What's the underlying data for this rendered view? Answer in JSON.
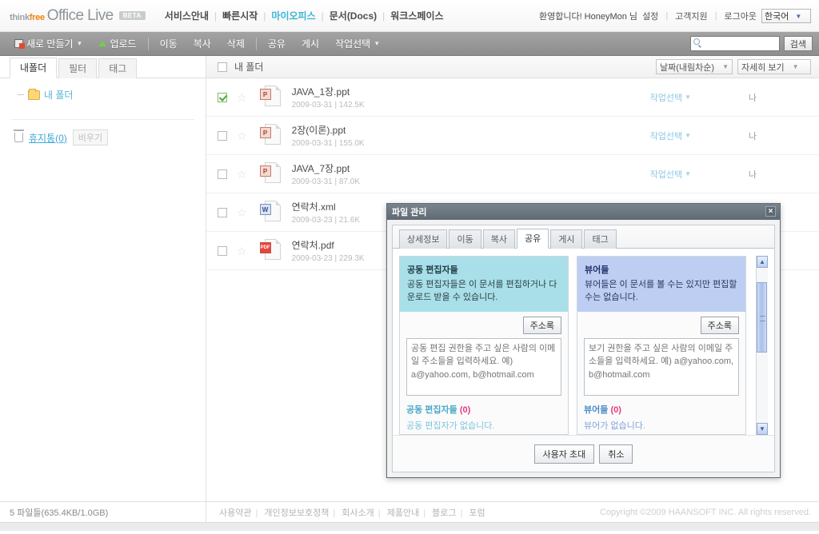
{
  "header": {
    "logo": {
      "think": "think",
      "free": "free",
      "product": "Office Live",
      "beta": "BETA"
    },
    "nav": [
      {
        "label": "서비스안내",
        "active": false
      },
      {
        "label": "빠른시작",
        "active": false
      },
      {
        "label": "마이오피스",
        "active": true
      },
      {
        "label": "문서(Docs)",
        "active": false
      },
      {
        "label": "워크스페이스",
        "active": false
      }
    ],
    "welcome": "환영합니다! HoneyMon 님",
    "links": [
      {
        "label": "설정"
      },
      {
        "label": "고객지원"
      },
      {
        "label": "로그아웃"
      }
    ],
    "language": "한국어"
  },
  "toolbar": {
    "items": [
      {
        "label": "새로 만들기",
        "icon": "new-document-icon",
        "caret": true
      },
      {
        "label": "업로드",
        "icon": "upload-icon",
        "caret": false
      },
      {
        "label": "이동",
        "icon": "",
        "caret": false
      },
      {
        "label": "복사",
        "icon": "",
        "caret": false
      },
      {
        "label": "삭제",
        "icon": "",
        "caret": false
      },
      {
        "label": "공유",
        "icon": "",
        "caret": false
      },
      {
        "label": "게시",
        "icon": "",
        "caret": false
      },
      {
        "label": "작업선택",
        "icon": "",
        "caret": true
      }
    ],
    "search": {
      "value": "",
      "placeholder": "",
      "button_label": "검색"
    }
  },
  "sidebar": {
    "tabs": [
      {
        "label": "내폴더",
        "active": true
      },
      {
        "label": "필터",
        "active": false
      },
      {
        "label": "태그",
        "active": false
      }
    ],
    "folder": {
      "label": "내 폴더"
    },
    "trash": {
      "label": "휴지통(0)",
      "empty_button": "비우기"
    }
  },
  "list": {
    "header": {
      "label": "내 폴더",
      "checked": false
    },
    "sort_select": "날짜(내림차순)",
    "view_select": "자세히 보기",
    "rows": [
      {
        "checked": true,
        "starred": false,
        "type": "ppt",
        "badge": "P",
        "name": "JAVA_1장.ppt",
        "date": "2009-03-31",
        "size": "142.5K",
        "action": "작업선택",
        "owner": "나"
      },
      {
        "checked": false,
        "starred": false,
        "type": "ppt",
        "badge": "P",
        "name": "2장(이론).ppt",
        "date": "2009-03-31",
        "size": "155.0K",
        "action": "작업선택",
        "owner": "나"
      },
      {
        "checked": false,
        "starred": false,
        "type": "ppt",
        "badge": "P",
        "name": "JAVA_7장.ppt",
        "date": "2009-03-31",
        "size": "87.0K",
        "action": "작업선택",
        "owner": "나"
      },
      {
        "checked": false,
        "starred": false,
        "type": "doc",
        "badge": "W",
        "name": "연락처.xml",
        "date": "2009-03-23",
        "size": "21.6K",
        "action": "",
        "owner": ""
      },
      {
        "checked": false,
        "starred": false,
        "type": "pdf",
        "badge": "PDF",
        "name": "연락처.pdf",
        "date": "2009-03-23",
        "size": "229.3K",
        "action": "",
        "owner": ""
      }
    ]
  },
  "modal": {
    "title": "파일 관리",
    "close_label": "×",
    "tabs": [
      {
        "label": "상세정보",
        "active": false
      },
      {
        "label": "이동",
        "active": false
      },
      {
        "label": "복사",
        "active": false
      },
      {
        "label": "공유",
        "active": true
      },
      {
        "label": "게시",
        "active": false
      },
      {
        "label": "태그",
        "active": false
      }
    ],
    "editors": {
      "title": "공동 편집자들",
      "description": "공동 편집자들은 이 문서를 편집하거나 다운로드 받을 수 있습니다.",
      "address_book_label": "주소록",
      "input_value": "",
      "input_placeholder": "공동 편집 권한을 주고 싶은 사람의 이메일 주소들을 입력하세요. 예) a@yahoo.com, b@hotmail.com",
      "count_label": "공동 편집자들",
      "count_value": "(0)",
      "empty_text": "공동 편집자가 없습니다."
    },
    "viewers": {
      "title": "뷰어들",
      "description": "뷰어들은 이 문서를 볼 수는 있지만 편집할 수는 없습니다.",
      "address_book_label": "주소록",
      "input_value": "",
      "input_placeholder": "보기 권한을 주고 싶은 사람의 이메일 주소들을 입력하세요. 예) a@yahoo.com, b@hotmail.com",
      "count_label": "뷰어들",
      "count_value": "(0)",
      "empty_text": "뷰어가 없습니다."
    },
    "scrollbar": {
      "up": "▲",
      "down": "▼"
    },
    "footer": {
      "invite_label": "사용자 초대",
      "cancel_label": "취소"
    }
  },
  "status": {
    "files_summary": "5 파일들(635.4KB/1.0GB)",
    "footer_links": [
      {
        "label": "사용약관"
      },
      {
        "label": "개인정보보호정책"
      },
      {
        "label": "회사소개"
      },
      {
        "label": "제품안내"
      },
      {
        "label": "블로그"
      },
      {
        "label": "포럼"
      }
    ],
    "copyright": "Copyright ©2009 HAANSOFT INC. All rights reserved."
  },
  "colors": {
    "accent": "#37b6d9",
    "toolbar": "#979797",
    "editors_panel": "#a9dfe8",
    "viewers_panel": "#bdcef2",
    "modal_titlebar": "#6a757f",
    "count_number": "#e5397f"
  }
}
